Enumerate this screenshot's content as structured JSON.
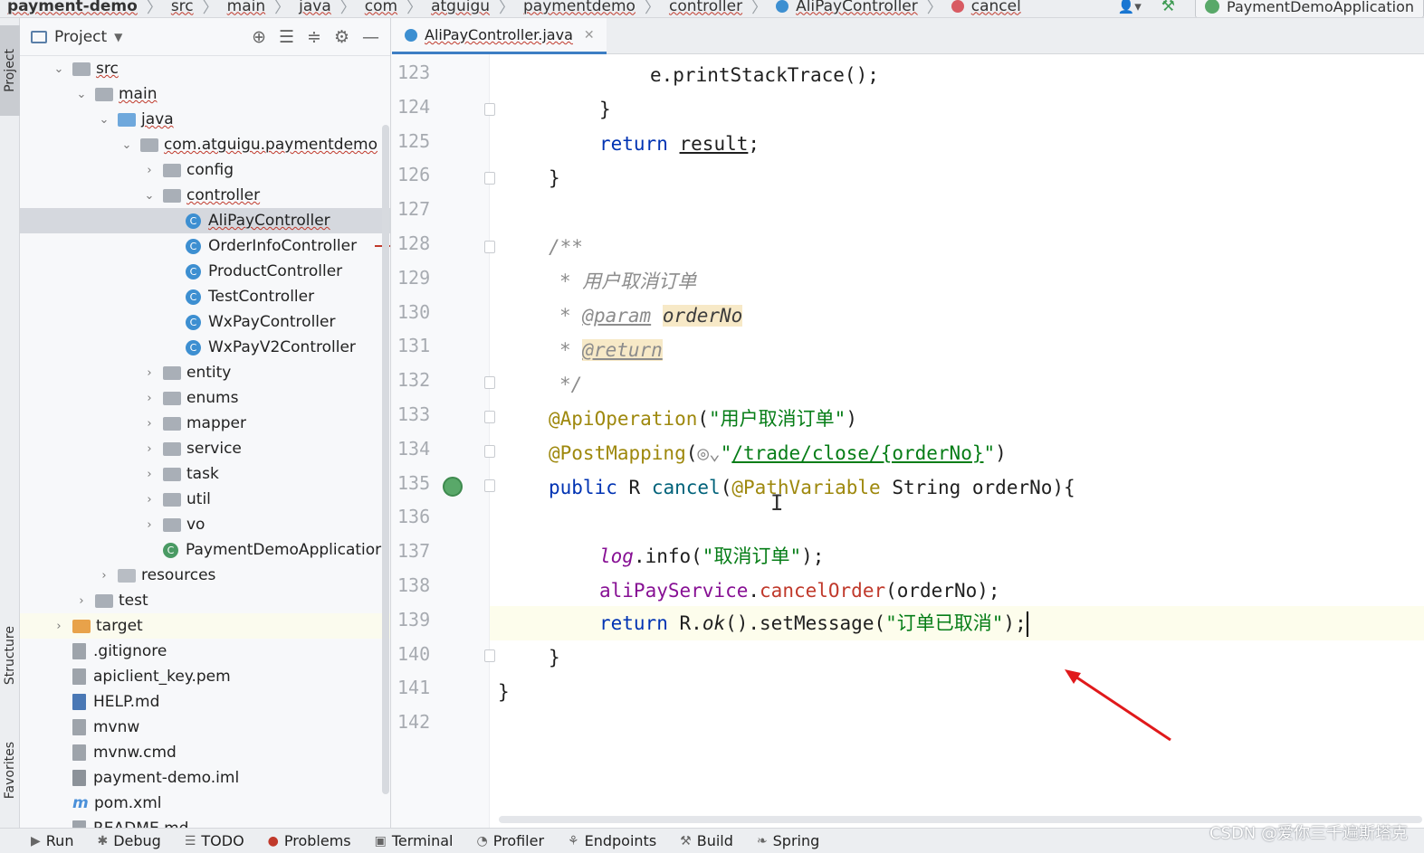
{
  "navbar": {
    "crumbs": [
      "payment-demo",
      "src",
      "main",
      "java",
      "com",
      "atguigu",
      "paymentdemo",
      "controller",
      "AliPayController",
      "cancel"
    ],
    "run_config": "PaymentDemoApplication"
  },
  "left_strip": {
    "project": "Project",
    "structure": "Structure",
    "favorites": "Favorites"
  },
  "project_panel": {
    "title": "Project",
    "tree": [
      {
        "label": "src",
        "depth": 0,
        "arrow": "open",
        "icon": "folder"
      },
      {
        "label": "main",
        "depth": 1,
        "arrow": "open",
        "icon": "folder"
      },
      {
        "label": "java",
        "depth": 2,
        "arrow": "open",
        "icon": "folder-blue"
      },
      {
        "label": "com.atguigu.paymentdemo",
        "depth": 3,
        "arrow": "open",
        "icon": "package"
      },
      {
        "label": "config",
        "depth": 4,
        "arrow": "closed",
        "icon": "package"
      },
      {
        "label": "controller",
        "depth": 4,
        "arrow": "open",
        "icon": "package"
      },
      {
        "label": "AliPayController",
        "depth": 5,
        "arrow": "none",
        "icon": "class",
        "selected": true
      },
      {
        "label": "OrderInfoController",
        "depth": 5,
        "arrow": "none",
        "icon": "class"
      },
      {
        "label": "ProductController",
        "depth": 5,
        "arrow": "none",
        "icon": "class"
      },
      {
        "label": "TestController",
        "depth": 5,
        "arrow": "none",
        "icon": "class"
      },
      {
        "label": "WxPayController",
        "depth": 5,
        "arrow": "none",
        "icon": "class"
      },
      {
        "label": "WxPayV2Controller",
        "depth": 5,
        "arrow": "none",
        "icon": "class"
      },
      {
        "label": "entity",
        "depth": 4,
        "arrow": "closed",
        "icon": "package"
      },
      {
        "label": "enums",
        "depth": 4,
        "arrow": "closed",
        "icon": "package"
      },
      {
        "label": "mapper",
        "depth": 4,
        "arrow": "closed",
        "icon": "package"
      },
      {
        "label": "service",
        "depth": 4,
        "arrow": "closed",
        "icon": "package"
      },
      {
        "label": "task",
        "depth": 4,
        "arrow": "closed",
        "icon": "package"
      },
      {
        "label": "util",
        "depth": 4,
        "arrow": "closed",
        "icon": "package"
      },
      {
        "label": "vo",
        "depth": 4,
        "arrow": "closed",
        "icon": "package"
      },
      {
        "label": "PaymentDemoApplicatior",
        "depth": 4,
        "arrow": "none",
        "icon": "app-class"
      },
      {
        "label": "resources",
        "depth": 2,
        "arrow": "closed",
        "icon": "resources"
      },
      {
        "label": "test",
        "depth": 1,
        "arrow": "closed",
        "icon": "folder"
      },
      {
        "label": "target",
        "depth": 0,
        "arrow": "closed",
        "icon": "folder-orange",
        "highlight": true
      },
      {
        "label": ".gitignore",
        "depth": 0,
        "arrow": "none",
        "icon": "file"
      },
      {
        "label": "apiclient_key.pem",
        "depth": 0,
        "arrow": "none",
        "icon": "file"
      },
      {
        "label": "HELP.md",
        "depth": 0,
        "arrow": "none",
        "icon": "file-md"
      },
      {
        "label": "mvnw",
        "depth": 0,
        "arrow": "none",
        "icon": "file"
      },
      {
        "label": "mvnw.cmd",
        "depth": 0,
        "arrow": "none",
        "icon": "file"
      },
      {
        "label": "payment-demo.iml",
        "depth": 0,
        "arrow": "none",
        "icon": "file-iml"
      },
      {
        "label": "pom.xml",
        "depth": 0,
        "arrow": "none",
        "icon": "maven"
      },
      {
        "label": "README.md",
        "depth": 0,
        "arrow": "none",
        "icon": "file"
      }
    ]
  },
  "editor": {
    "tab": "AliPayController.java",
    "line_numbers": [
      "123",
      "124",
      "125",
      "126",
      "127",
      "128",
      "129",
      "130",
      "131",
      "132",
      "133",
      "134",
      "135",
      "136",
      "137",
      "138",
      "139",
      "140",
      "141",
      "142"
    ],
    "code": {
      "l123": "e.printStackTrace();",
      "l124": "}",
      "l125_kw": "return",
      "l125_var": "result",
      "l125_end": ";",
      "l126": "}",
      "l128": "/**",
      "l129_star": "* ",
      "l129_text": "用户取消订单",
      "l130_star": "* ",
      "l130_tag": "@param",
      "l130_name": "orderNo",
      "l131_star": "* ",
      "l131_tag": "@return",
      "l132": "*/",
      "l133_ann": "@ApiOperation",
      "l133_open": "(",
      "l133_str": "\"用户取消订单\"",
      "l133_close": ")",
      "l134_ann": "@PostMapping",
      "l134_open": "(",
      "l134_globe": "◎",
      "l134_chev": "⌄",
      "l134_q1": "\"",
      "l134_url": "/trade/close/{orderNo}",
      "l134_q2": "\"",
      "l134_close": ")",
      "l135_kw": "public",
      "l135_type": "R",
      "l135_mth": "cancel",
      "l135_open": "(",
      "l135_ann": "@PathVariable",
      "l135_ptype": "String",
      "l135_pname": "orderNo",
      "l135_close": "){",
      "l137_fld": "log",
      "l137_call": ".info(",
      "l137_str": "\"取消订单\"",
      "l137_end": ");",
      "l138_fld": "aliPayService",
      "l138_dot": ".",
      "l138_mth": "cancelOrder",
      "l138_args": "(orderNo);",
      "l139_kw": "return",
      "l139_r": "R.",
      "l139_ok": "ok",
      "l139_call": "().setMessage(",
      "l139_str": "\"订单已取消\"",
      "l139_end": ");",
      "l140": "}",
      "l141": "}"
    }
  },
  "bottom_bar": {
    "items": [
      {
        "icon": "▶",
        "label": "Run"
      },
      {
        "icon": "✱",
        "label": "Debug"
      },
      {
        "icon": "☰",
        "label": "TODO"
      },
      {
        "icon": "●",
        "label": "Problems"
      },
      {
        "icon": "▣",
        "label": "Terminal"
      },
      {
        "icon": "◔",
        "label": "Profiler"
      },
      {
        "icon": "⚘",
        "label": "Endpoints"
      },
      {
        "icon": "⚒",
        "label": "Build"
      },
      {
        "icon": "❧",
        "label": "Spring"
      }
    ]
  },
  "watermark": "CSDN @爱你三千遍斯塔克",
  "colors": {
    "keyword": "#0033b3",
    "annotation": "#9e880d",
    "string": "#067d17",
    "comment": "#8c8c8c",
    "field": "#871094",
    "selection": "#d5d8de",
    "accent": "#3d7ec4",
    "arrow": "#e0191b"
  }
}
